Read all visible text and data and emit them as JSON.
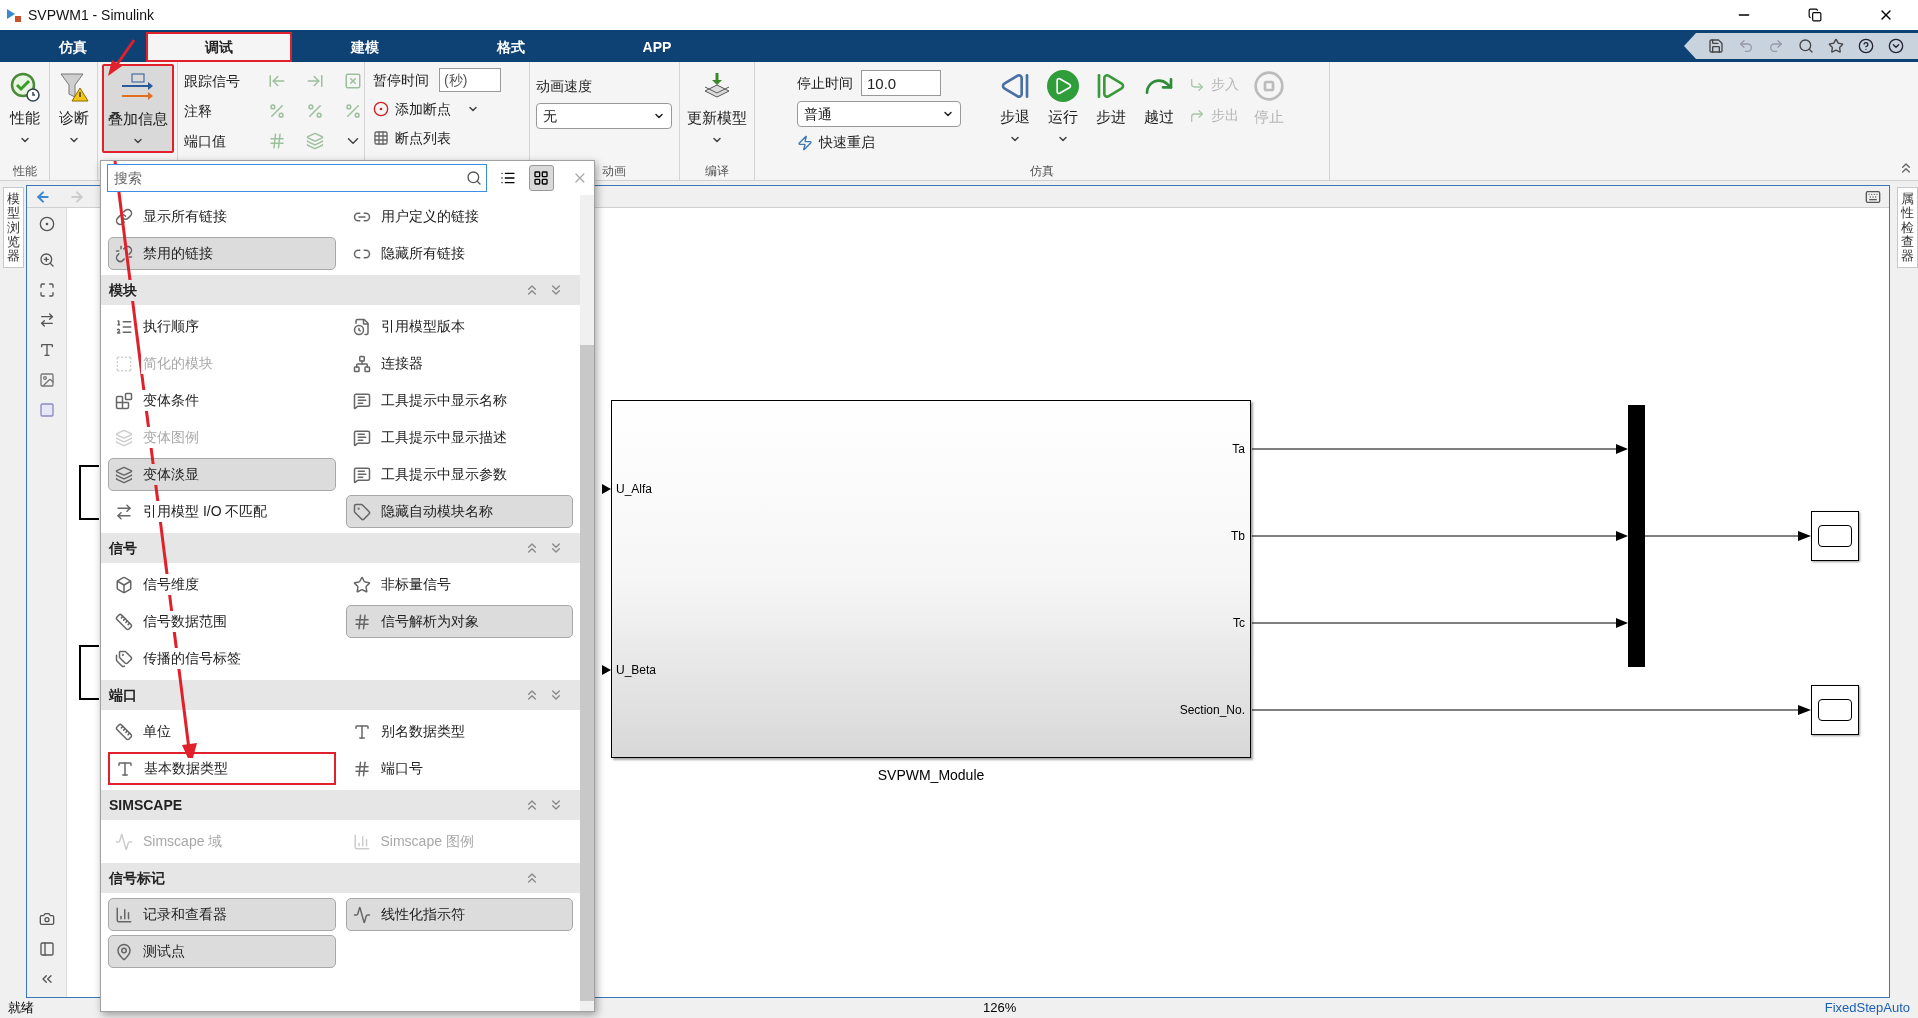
{
  "window": {
    "title": "SVPWM1 - Simulink"
  },
  "tabs": [
    {
      "label": "仿真",
      "selected": false,
      "highlighted": false
    },
    {
      "label": "调试",
      "selected": true,
      "highlighted": true
    },
    {
      "label": "建模",
      "selected": false,
      "highlighted": false
    },
    {
      "label": "格式",
      "selected": false,
      "highlighted": false
    },
    {
      "label": "APP",
      "selected": false,
      "highlighted": false
    }
  ],
  "ribbon": {
    "groups": [
      {
        "kind": "large",
        "label": "性能",
        "buttons": [
          {
            "label": "性能",
            "dropdown": true,
            "pressed": false,
            "highlighted": false
          }
        ]
      },
      {
        "kind": "large",
        "buttons": [
          {
            "label": "诊断",
            "dropdown": true,
            "pressed": false,
            "highlighted": false
          }
        ]
      },
      {
        "kind": "large",
        "buttons": [
          {
            "label": "叠加信息",
            "dropdown": true,
            "pressed": true,
            "highlighted": true
          }
        ]
      },
      {
        "kind": "trace",
        "rows": [
          {
            "label": "跟踪信号"
          },
          {
            "label": "注释"
          },
          {
            "label": "端口值"
          }
        ]
      },
      {
        "kind": "pause",
        "field": {
          "label": "暂停时间",
          "placeholder": "(秒)"
        },
        "items": [
          {
            "label": "添加断点",
            "dropdown": true
          },
          {
            "label": "断点列表"
          }
        ]
      },
      {
        "kind": "anim",
        "label": "动画",
        "field_label": "动画速度",
        "value": "无"
      },
      {
        "kind": "large",
        "label": "编译",
        "buttons": [
          {
            "label": "更新模型",
            "dropdown": true,
            "pressed": false,
            "highlighted": false
          }
        ]
      },
      {
        "kind": "sim",
        "label": "仿真",
        "stop_time": {
          "label": "停止时间",
          "value": "10.0"
        },
        "mode": "普通",
        "fast_restart": "快速重启",
        "buttons": [
          {
            "kind": "large",
            "label": "步退",
            "dropdown": true,
            "disabled": false
          },
          {
            "kind": "large",
            "label": "运行",
            "dropdown": true,
            "disabled": false
          },
          {
            "kind": "large",
            "label": "步进",
            "disabled": false
          },
          {
            "kind": "large",
            "label": "越过",
            "disabled": false
          },
          {
            "kind": "small",
            "label": "步入",
            "disabled": true
          },
          {
            "kind": "small",
            "label": "步出",
            "disabled": true
          },
          {
            "kind": "large",
            "label": "停止",
            "disabled": true
          }
        ]
      }
    ]
  },
  "side_tabs": {
    "left": "模型浏览器",
    "right": "属性检查器"
  },
  "menu": {
    "search": {
      "placeholder": "搜索"
    },
    "grid_view": true,
    "sections": [
      {
        "items": [
          {
            "label": "显示所有链接",
            "selected": false,
            "disabled": false,
            "highlighted": false
          },
          {
            "label": "用户定义的链接",
            "selected": false,
            "disabled": false,
            "highlighted": false
          },
          {
            "label": "禁用的链接",
            "selected": true,
            "disabled": false,
            "highlighted": false
          },
          {
            "label": "隐藏所有链接",
            "selected": false,
            "disabled": false,
            "highlighted": false
          }
        ]
      },
      {
        "title": "模块",
        "expand_all": true,
        "items": [
          {
            "label": "执行顺序",
            "selected": false,
            "disabled": false,
            "highlighted": false
          },
          {
            "label": "引用模型版本",
            "selected": false,
            "disabled": false,
            "highlighted": false
          },
          {
            "label": "简化的模块",
            "selected": false,
            "disabled": true,
            "highlighted": false
          },
          {
            "label": "连接器",
            "selected": false,
            "disabled": false,
            "highlighted": false
          },
          {
            "label": "变体条件",
            "selected": false,
            "disabled": false,
            "highlighted": false
          },
          {
            "label": "工具提示中显示名称",
            "selected": false,
            "disabled": false,
            "highlighted": false
          },
          {
            "label": "变体图例",
            "selected": false,
            "disabled": true,
            "highlighted": false
          },
          {
            "label": "工具提示中显示描述",
            "selected": false,
            "disabled": false,
            "highlighted": false
          },
          {
            "label": "变体淡显",
            "selected": true,
            "disabled": false,
            "highlighted": false
          },
          {
            "label": "工具提示中显示参数",
            "selected": false,
            "disabled": false,
            "highlighted": false
          },
          {
            "label": "引用模型 I/O 不匹配",
            "selected": false,
            "disabled": false,
            "highlighted": false
          },
          {
            "label": "隐藏自动模块名称",
            "selected": true,
            "disabled": false,
            "highlighted": false
          }
        ]
      },
      {
        "title": "信号",
        "expand_all": true,
        "items": [
          {
            "label": "信号维度",
            "selected": false,
            "disabled": false,
            "highlighted": false
          },
          {
            "label": "非标量信号",
            "selected": false,
            "disabled": false,
            "highlighted": false
          },
          {
            "label": "信号数据范围",
            "selected": false,
            "disabled": false,
            "highlighted": false
          },
          {
            "label": "信号解析为对象",
            "selected": true,
            "disabled": false,
            "highlighted": false
          },
          {
            "label": "传播的信号标签",
            "selected": false,
            "disabled": false,
            "highlighted": false
          }
        ]
      },
      {
        "title": "端口",
        "expand_all": true,
        "items": [
          {
            "label": "单位",
            "selected": false,
            "disabled": false,
            "highlighted": false
          },
          {
            "label": "别名数据类型",
            "selected": false,
            "disabled": false,
            "highlighted": false
          },
          {
            "label": "基本数据类型",
            "selected": false,
            "disabled": false,
            "highlighted": true
          },
          {
            "label": "端口号",
            "selected": false,
            "disabled": false,
            "highlighted": false
          }
        ]
      },
      {
        "title": "SIMSCAPE",
        "expand_all": true,
        "items": [
          {
            "label": "Simscape 域",
            "selected": false,
            "disabled": true,
            "highlighted": false
          },
          {
            "label": "Simscape 图例",
            "selected": false,
            "disabled": true,
            "highlighted": false
          }
        ]
      },
      {
        "title": "信号标记",
        "expand_all": false,
        "items": [
          {
            "label": "记录和查看器",
            "selected": true,
            "disabled": false,
            "highlighted": false
          },
          {
            "label": "线性化指示符",
            "selected": true,
            "disabled": false,
            "highlighted": false
          },
          {
            "label": "测试点",
            "selected": true,
            "disabled": false,
            "highlighted": false
          }
        ]
      }
    ]
  },
  "canvas": {
    "block": {
      "name": "SVPWM_Module",
      "inputs": [
        "U_Alfa",
        "U_Beta"
      ],
      "outputs": [
        "Ta",
        "Tb",
        "Tc",
        "Section_No."
      ]
    }
  },
  "status_bar": {
    "state": "就绪",
    "zoom": "126%",
    "solver": "FixedStepAuto"
  }
}
